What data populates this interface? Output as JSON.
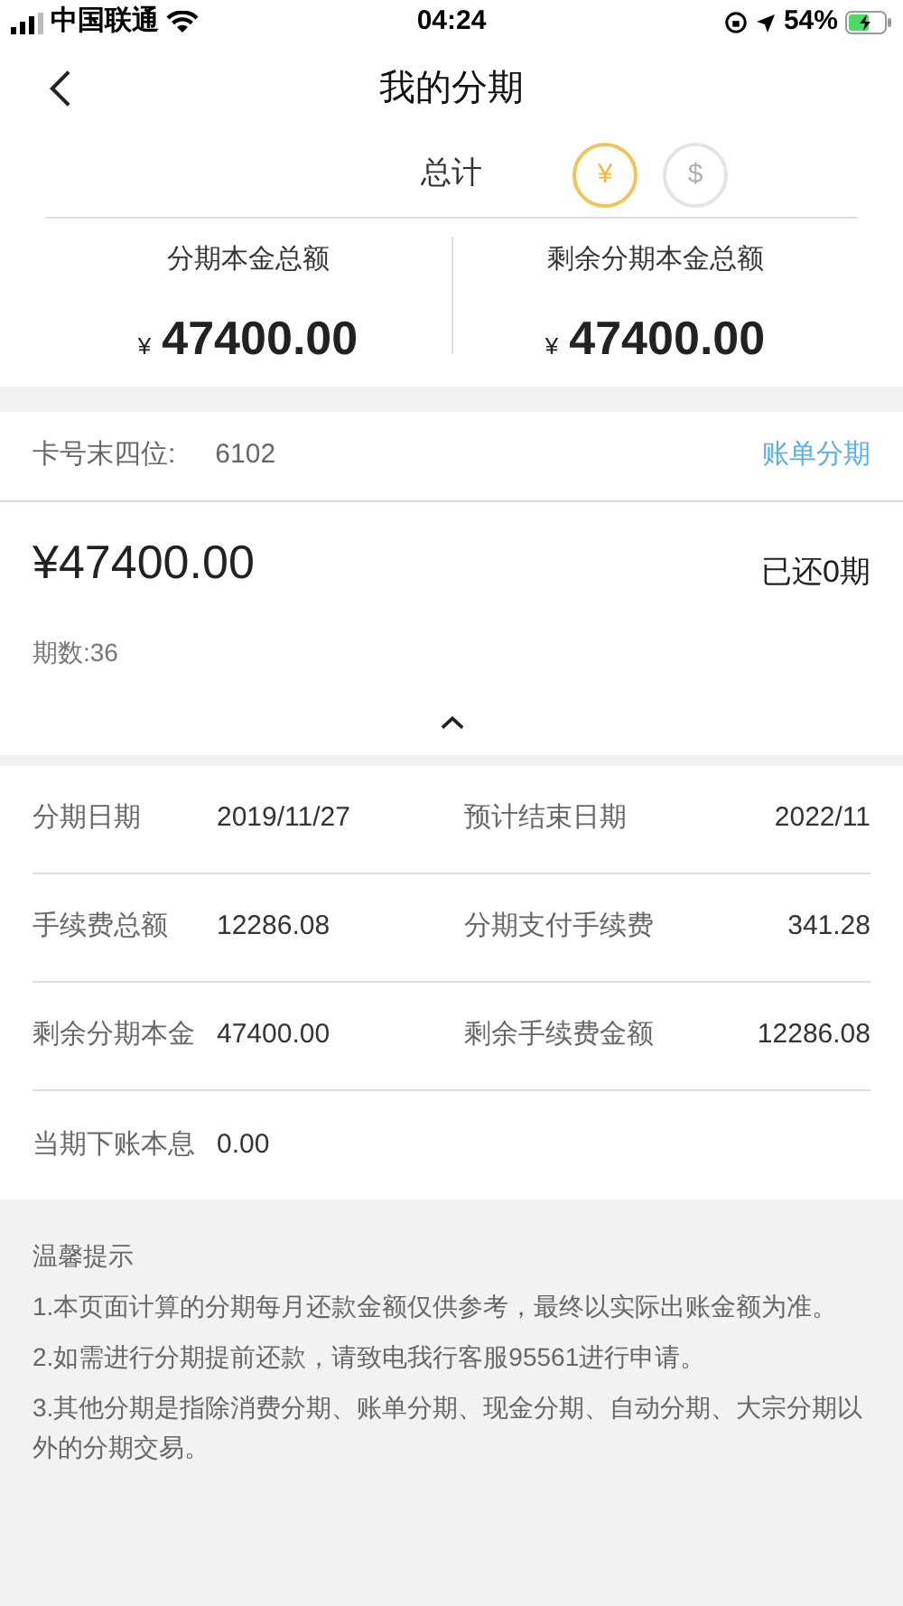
{
  "status_bar": {
    "carrier": "中国联通",
    "time": "04:24",
    "battery": "54%"
  },
  "nav": {
    "title": "我的分期"
  },
  "total": {
    "label": "总计",
    "currencies": [
      {
        "symbol": "¥",
        "selected": true
      },
      {
        "symbol": "$",
        "selected": false
      }
    ]
  },
  "summary": [
    {
      "label": "分期本金总额",
      "currency": "¥",
      "amount": "47400.00"
    },
    {
      "label": "剩余分期本金总额",
      "currency": "¥",
      "amount": "47400.00"
    }
  ],
  "card": {
    "label": "卡号末四位:",
    "number": "6102",
    "type": "账单分期"
  },
  "plan": {
    "amount": "¥47400.00",
    "paid": "已还0期",
    "periods": "期数:36",
    "expanded": true
  },
  "details": [
    [
      {
        "label": "分期日期",
        "value": "2019/11/27"
      },
      {
        "label": "预计结束日期",
        "value": "2022/11"
      }
    ],
    [
      {
        "label": "手续费总额",
        "value": "12286.08"
      },
      {
        "label": "分期支付手续费",
        "value": "341.28"
      }
    ],
    [
      {
        "label": "剩余分期本金",
        "value": "47400.00"
      },
      {
        "label": "剩余手续费金额",
        "value": "12286.08"
      }
    ],
    [
      {
        "label": "当期下账本息",
        "value": "0.00"
      }
    ]
  ],
  "tips": {
    "title": "温馨提示",
    "items": [
      "1.本页面计算的分期每月还款金额仅供参考，最终以实际出账金额为准。",
      "2.如需进行分期提前还款，请致电我行客服95561进行申请。",
      "3.其他分期是指除消费分期、账单分期、现金分期、自动分期、大宗分期以外的分期交易。"
    ]
  }
}
